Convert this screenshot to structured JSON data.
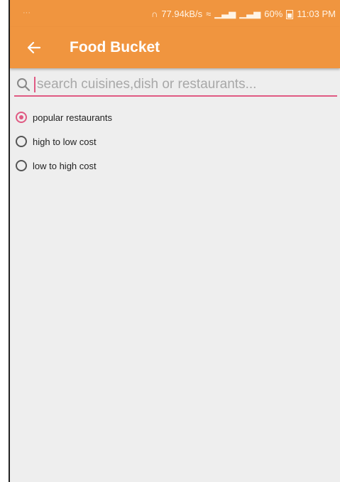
{
  "status_bar": {
    "speed": "77.94kB/s",
    "battery": "60%",
    "time": "11:03 PM"
  },
  "app_bar": {
    "title": "Food Bucket"
  },
  "search": {
    "placeholder": "search cuisines,dish or restaurants..."
  },
  "sort_options": [
    {
      "label": "popular restaurants",
      "checked": true
    },
    {
      "label": "high to low cost",
      "checked": false
    },
    {
      "label": "low to high cost",
      "checked": false
    }
  ],
  "colors": {
    "primary": "#f0953f",
    "accent": "#e05a83",
    "background": "#eeeeee"
  }
}
